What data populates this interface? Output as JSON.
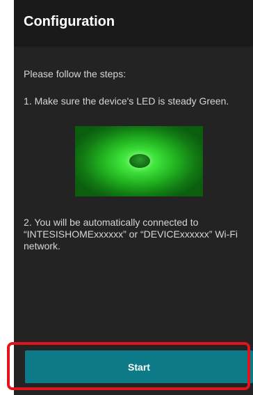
{
  "app_bar": {
    "title": "Configuration"
  },
  "content": {
    "intro": "Please follow the steps:",
    "step1": "1. Make sure the device's LED is steady Green.",
    "step2": "2. You will be automatically connected to “INTESISHOMExxxxxx” or “DEVICExxxxxx” Wi-Fi network."
  },
  "led_image": {
    "icon": "green-led-photo",
    "color": "#3fe23c"
  },
  "start_button": {
    "label": "Start",
    "color": "#0d7b87"
  },
  "highlight": {
    "color": "#e0141c"
  }
}
